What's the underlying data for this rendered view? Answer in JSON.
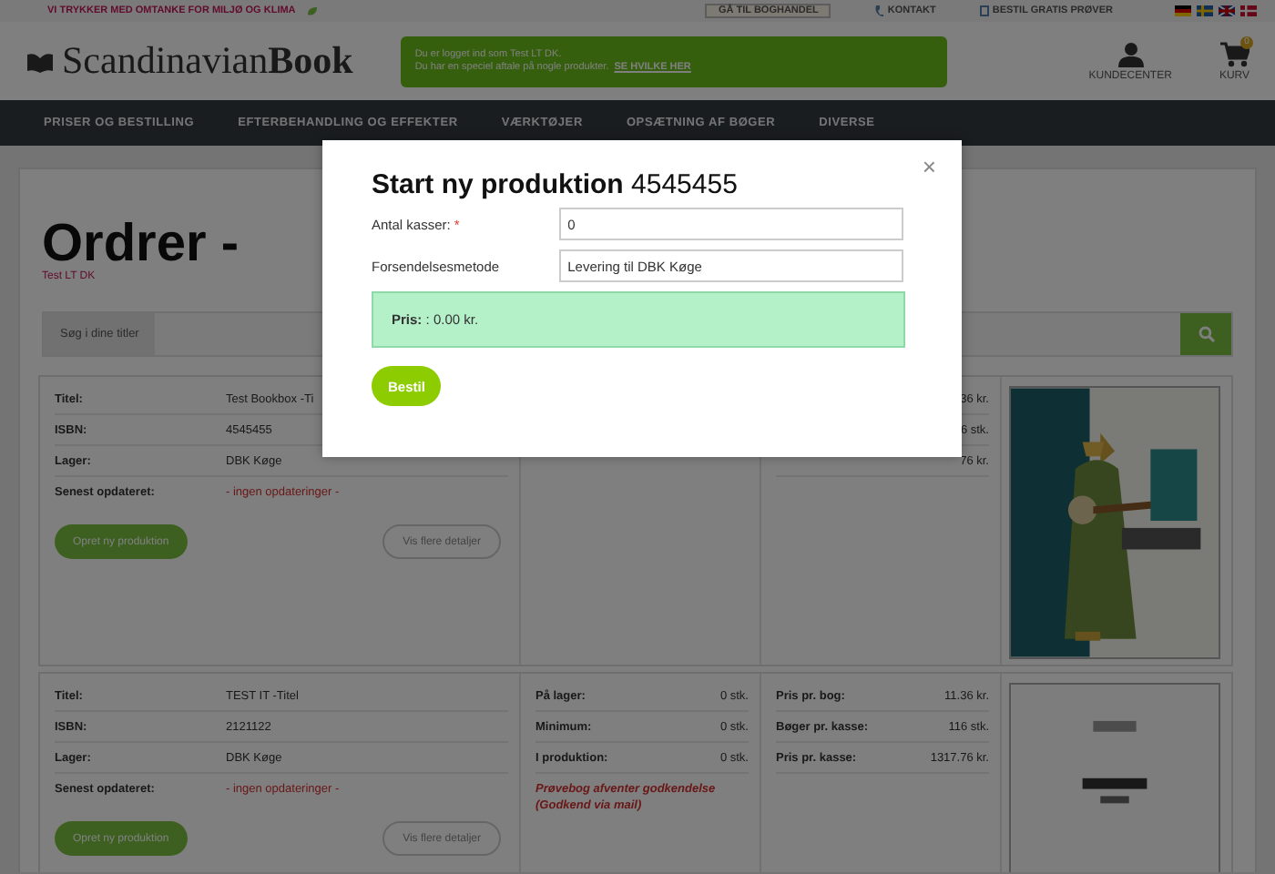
{
  "top_bar": {
    "slogan": "VI TRYKKER MED OMTANKE FOR MILJØ OG KLIMA",
    "links": [
      "GÅ TIL BOGHANDEL",
      "KONTAKT",
      "BESTIL GRATIS PRØVER"
    ]
  },
  "header": {
    "logo": "Scandinavian**Book**",
    "notice": {
      "line1": "Du er logget ind som Test LT DK.",
      "line2": "Du har en speciel aftale på nogle produkter.",
      "link": "SE HVILKE HER"
    },
    "account": "KUNDECENTER",
    "cart": {
      "label": "KURV",
      "count": "0"
    }
  },
  "nav": [
    "PRISER OG BESTILLING",
    "EFTERBEHANDLING OG EFFEKTER",
    "VÆRKTØJER",
    "OPSÆTNING AF BØGER",
    "DIVERSE"
  ],
  "page": {
    "title": "Ordrer -",
    "customer": "Test LT DK",
    "search": {
      "label": "Søg i dine titler"
    }
  },
  "orders": [
    {
      "details": [
        {
          "label": "Titel:",
          "value": "Test Bookbox -Ti"
        },
        {
          "label": "ISBN:",
          "value": "4545455"
        },
        {
          "label": "Lager:",
          "value": "DBK Køge"
        },
        {
          "label": "Senest opdateret:",
          "value": "- ingen opdateringer -"
        }
      ],
      "prices": [
        {
          "value": "36 kr."
        },
        {
          "value": "6 stk."
        },
        {
          "value": "76 kr."
        }
      ],
      "buttons": [
        "Opret ny produktion",
        "Vis flere detaljer"
      ],
      "cover": {
        "kind": "picture"
      }
    },
    {
      "details": [
        {
          "label": "Titel:",
          "value": "TEST IT -Titel"
        },
        {
          "label": "ISBN:",
          "value": "2121122"
        },
        {
          "label": "Lager:",
          "value": "DBK Køge"
        },
        {
          "label": "Senest opdateret:",
          "value": "- ingen opdateringer -"
        }
      ],
      "stock": [
        {
          "label": "På lager:",
          "value": "0 stk."
        },
        {
          "label": "Minimum:",
          "value": "0 stk."
        },
        {
          "label": "I produktion:",
          "value": "0 stk."
        }
      ],
      "warning": "Prøvebog afventer godkendelse (Godkend via mail)",
      "prices": [
        {
          "label": "Pris pr. bog:",
          "value": "11.36 kr."
        },
        {
          "label": "Bøger pr. kasse:",
          "value": "116 stk."
        },
        {
          "label": "Pris pr. kasse:",
          "value": "1317.76 kr."
        }
      ],
      "buttons": [
        "Opret ny produktion",
        "Vis flere detaljer"
      ],
      "cover": {
        "kind": "picture"
      }
    }
  ],
  "modal": {
    "title": "**Start ny produktion** 4545455",
    "close": "×",
    "fields": [
      {
        "kind": "input",
        "label": "Antal kasser:",
        "required_mark": "*",
        "value": "0"
      },
      {
        "kind": "select",
        "label": "Forsendelsesmetode",
        "value": "Levering til DBK Køge"
      }
    ],
    "price": "**Pris:** : 0.00 kr.",
    "button": "Bestil"
  }
}
